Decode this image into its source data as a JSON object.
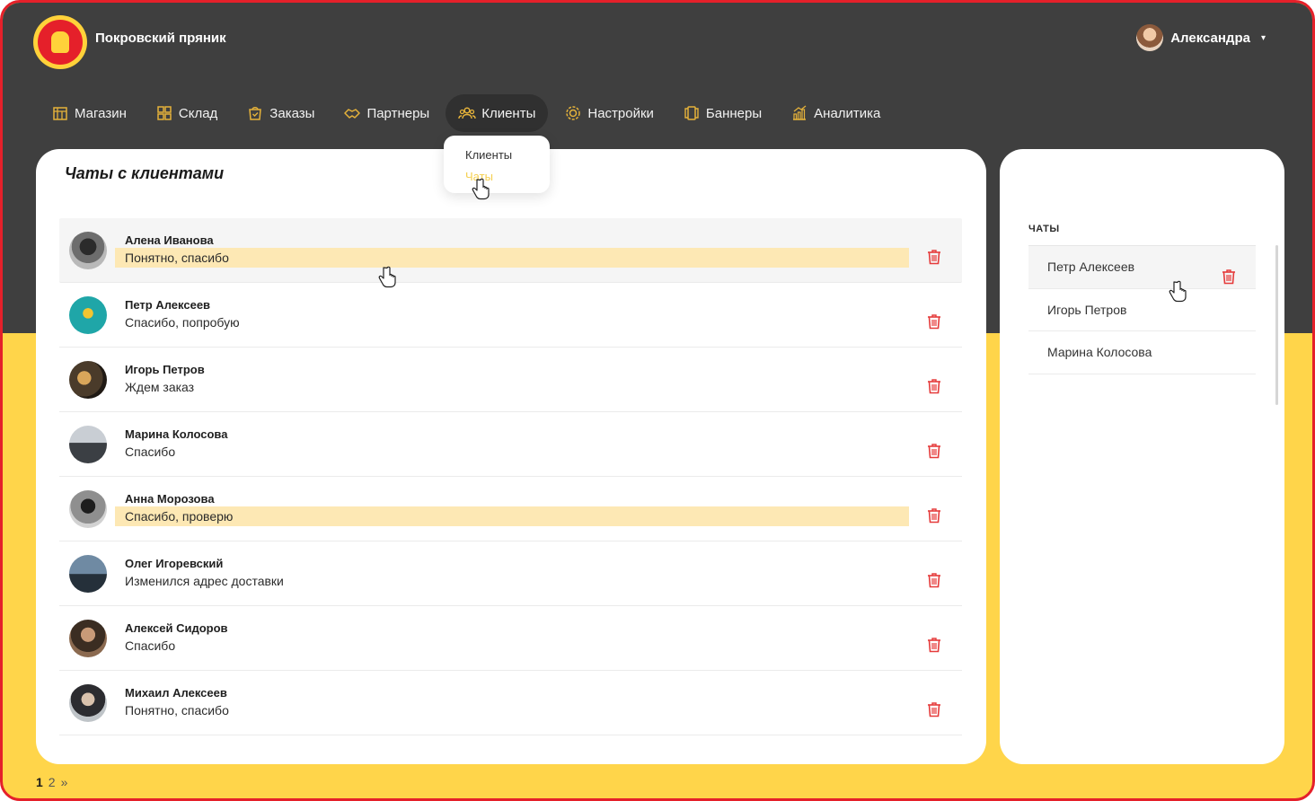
{
  "app": {
    "brand": "Покровский пряник"
  },
  "user": {
    "name": "Александра",
    "caret": "▾"
  },
  "nav": [
    {
      "label": "Магазин",
      "icon": "store-icon",
      "active": false
    },
    {
      "label": "Склад",
      "icon": "warehouse-icon",
      "active": false
    },
    {
      "label": "Заказы",
      "icon": "orders-bag-icon",
      "active": false
    },
    {
      "label": "Партнеры",
      "icon": "handshake-icon",
      "active": false
    },
    {
      "label": "Клиенты",
      "icon": "users-icon",
      "active": true
    },
    {
      "label": "Настройки",
      "icon": "gear-icon",
      "active": false
    },
    {
      "label": "Баннеры",
      "icon": "banners-icon",
      "active": false
    },
    {
      "label": "Аналитика",
      "icon": "analytics-icon",
      "active": false
    }
  ],
  "dropdown": {
    "items": [
      "Клиенты",
      "Чаты"
    ],
    "hovered": 1
  },
  "main": {
    "title": "Чаты с клиентами",
    "chats": [
      {
        "name": "Алена Иванова",
        "message": "Понятно, спасибо",
        "selected": true,
        "highlight": true
      },
      {
        "name": "Петр Алексеев",
        "message": "Спасибо, попробую",
        "selected": false,
        "highlight": false
      },
      {
        "name": "Игорь Петров",
        "message": "Ждем заказ",
        "selected": false,
        "highlight": false
      },
      {
        "name": "Марина Колосова",
        "message": "Спасибо",
        "selected": false,
        "highlight": false
      },
      {
        "name": "Анна Морозова",
        "message": "Спасибо, проверю",
        "selected": false,
        "highlight": true
      },
      {
        "name": "Олег Игоревский",
        "message": "Изменился адрес доставки",
        "selected": false,
        "highlight": false
      },
      {
        "name": "Алексей Сидоров",
        "message": "Спасибо",
        "selected": false,
        "highlight": false
      },
      {
        "name": "Михаил Алексеев",
        "message": "Понятно, спасибо",
        "selected": false,
        "highlight": false
      }
    ]
  },
  "pagination": {
    "pages": [
      "1",
      "2"
    ],
    "current": "1",
    "next": "»"
  },
  "side": {
    "title": "ЧАТЫ",
    "items": [
      {
        "name": "Петр Алексеев",
        "selected": true
      },
      {
        "name": "Игорь Петров",
        "selected": false
      },
      {
        "name": "Марина Колосова",
        "selected": false
      }
    ]
  },
  "colors": {
    "accent_yellow": "#ffd54a",
    "header_dark": "#3f3f3f",
    "frame_red": "#e5202a",
    "highlight": "#fde8b4",
    "trash_red": "#e53b3b"
  }
}
